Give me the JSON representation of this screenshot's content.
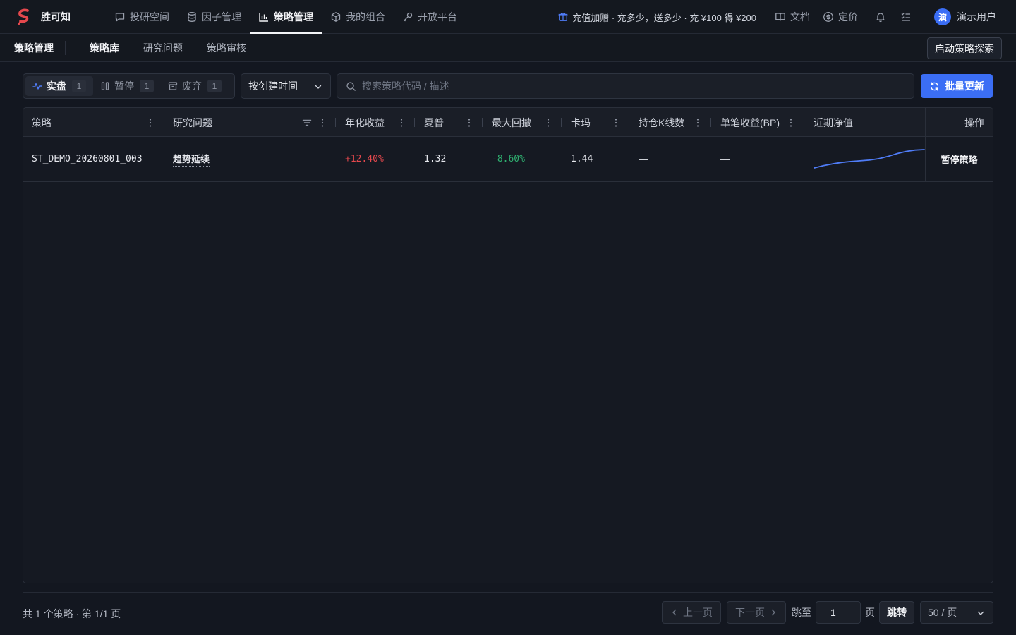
{
  "brand": {
    "name": "胜可知",
    "color": "#e5484d"
  },
  "nav": {
    "items": [
      {
        "label": "投研空间",
        "icon": "chat-icon",
        "active": false
      },
      {
        "label": "因子管理",
        "icon": "database-icon",
        "active": false
      },
      {
        "label": "策略管理",
        "icon": "bar-chart-icon",
        "active": true
      },
      {
        "label": "我的组合",
        "icon": "cube-icon",
        "active": false
      },
      {
        "label": "开放平台",
        "icon": "key-icon",
        "active": false
      }
    ],
    "promo": "充值加赠 · 充多少，送多少 · 充 ¥100 得 ¥200",
    "docs": "文档",
    "pricing": "定价",
    "user_initial": "演",
    "user_name": "演示用户"
  },
  "subnav": {
    "title": "策略管理",
    "tabs": [
      {
        "label": "策略库",
        "active": true
      },
      {
        "label": "研究问题",
        "active": false
      },
      {
        "label": "策略审核",
        "active": false
      }
    ],
    "explore_button": "启动策略探索"
  },
  "filters": {
    "status_tabs": [
      {
        "label": "实盘",
        "count": "1",
        "active": true,
        "icon": "pulse-icon"
      },
      {
        "label": "暂停",
        "count": "1",
        "active": false,
        "icon": "pause-icon"
      },
      {
        "label": "废弃",
        "count": "1",
        "active": false,
        "icon": "archive-icon"
      }
    ],
    "sort_label": "按创建时间",
    "search_placeholder": "搜索策略代码 / 描述",
    "bulk_update": "批量更新"
  },
  "table": {
    "columns": {
      "strategy": "策略",
      "topic": "研究问题",
      "annual": "年化收益",
      "sharpe": "夏普",
      "drawdown": "最大回撤",
      "calmar": "卡玛",
      "bars": "持仓K线数",
      "bp": "单笔收益(BP)",
      "nav": "近期净值",
      "ops": "操作"
    },
    "rows": [
      {
        "strategy": "ST_DEMO_20260801_003",
        "topic": "趋势延续",
        "annual": "+12.40%",
        "sharpe": "1.32",
        "drawdown": "-8.60%",
        "calmar": "1.44",
        "bars": "—",
        "bp": "—",
        "nav_series": [
          1.0,
          1.01,
          1.018,
          1.024,
          1.028,
          1.031,
          1.034,
          1.04,
          1.05,
          1.062,
          1.072,
          1.078,
          1.08
        ],
        "action": "暂停策略"
      }
    ]
  },
  "footer": {
    "summary": "共 1 个策略 · 第 1/1 页",
    "prev": "上一页",
    "next": "下一页",
    "jump_to": "跳至",
    "page_value": "1",
    "page_unit": "页",
    "jump_button": "跳转",
    "page_size": "50 / 页"
  },
  "colors": {
    "accent": "#3b6ef5",
    "positive": "#e5484d",
    "negative": "#2fb070",
    "sparkline": "#4f7cf7"
  }
}
